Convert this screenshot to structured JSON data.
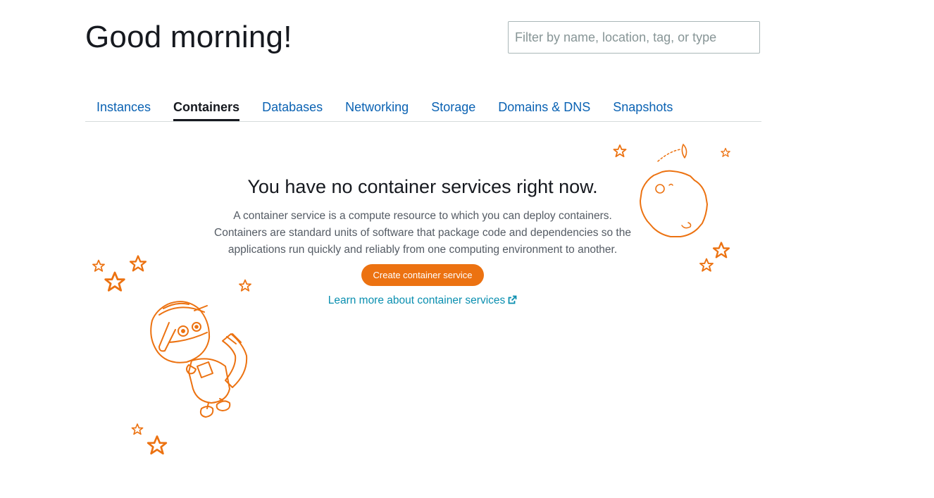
{
  "header": {
    "greeting": "Good morning!",
    "search_placeholder": "Filter by name, location, tag, or type"
  },
  "tabs": [
    {
      "label": "Instances",
      "active": false
    },
    {
      "label": "Containers",
      "active": true
    },
    {
      "label": "Databases",
      "active": false
    },
    {
      "label": "Networking",
      "active": false
    },
    {
      "label": "Storage",
      "active": false
    },
    {
      "label": "Domains & DNS",
      "active": false
    },
    {
      "label": "Snapshots",
      "active": false
    }
  ],
  "empty_state": {
    "title": "You have no container services right now.",
    "description": "A container service is a compute resource to which you can deploy containers. Containers are standard units of software that package code and dependencies so the applications run quickly and reliably from one computing environment to another.",
    "create_button": "Create container service",
    "learn_more_link": "Learn more about container services",
    "link_icon": "external-link-icon"
  },
  "illustration": {
    "accent_color": "#ec7211",
    "icons": [
      "robot-astronaut-icon",
      "moon-icon",
      "star-icon"
    ]
  }
}
